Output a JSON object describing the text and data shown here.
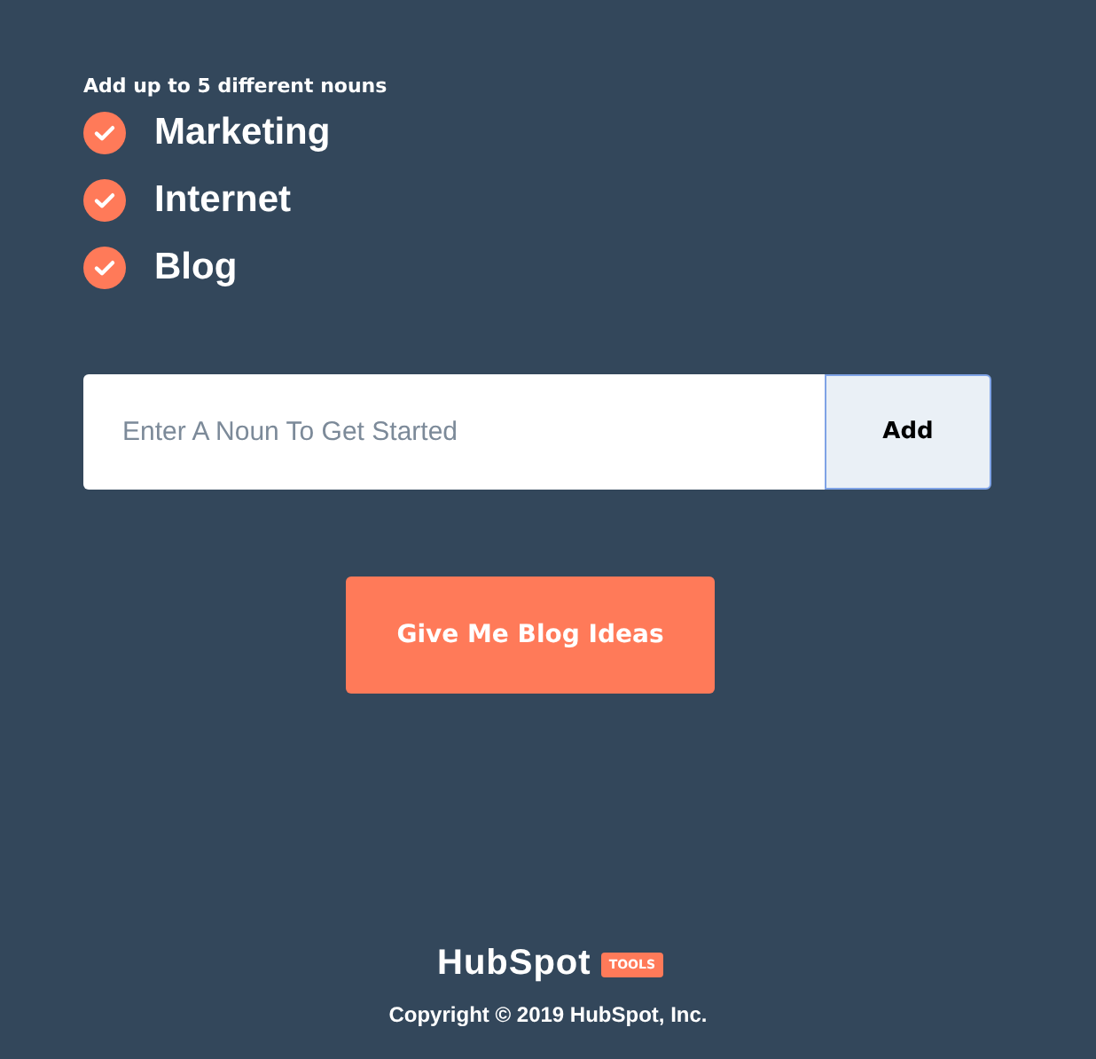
{
  "heading": "Add up to 5 different nouns",
  "nouns": [
    {
      "label": "Marketing",
      "checked": true
    },
    {
      "label": "Internet",
      "checked": true
    },
    {
      "label": "Blog",
      "checked": true
    }
  ],
  "noun_input": {
    "placeholder": "Enter A Noun To Get Started"
  },
  "add_button": "Add",
  "submit_button": "Give Me Blog Ideas",
  "footer": {
    "logo": "HubSpot",
    "badge": "TOOLS",
    "copyright": "Copyright © 2019 HubSpot, Inc."
  }
}
